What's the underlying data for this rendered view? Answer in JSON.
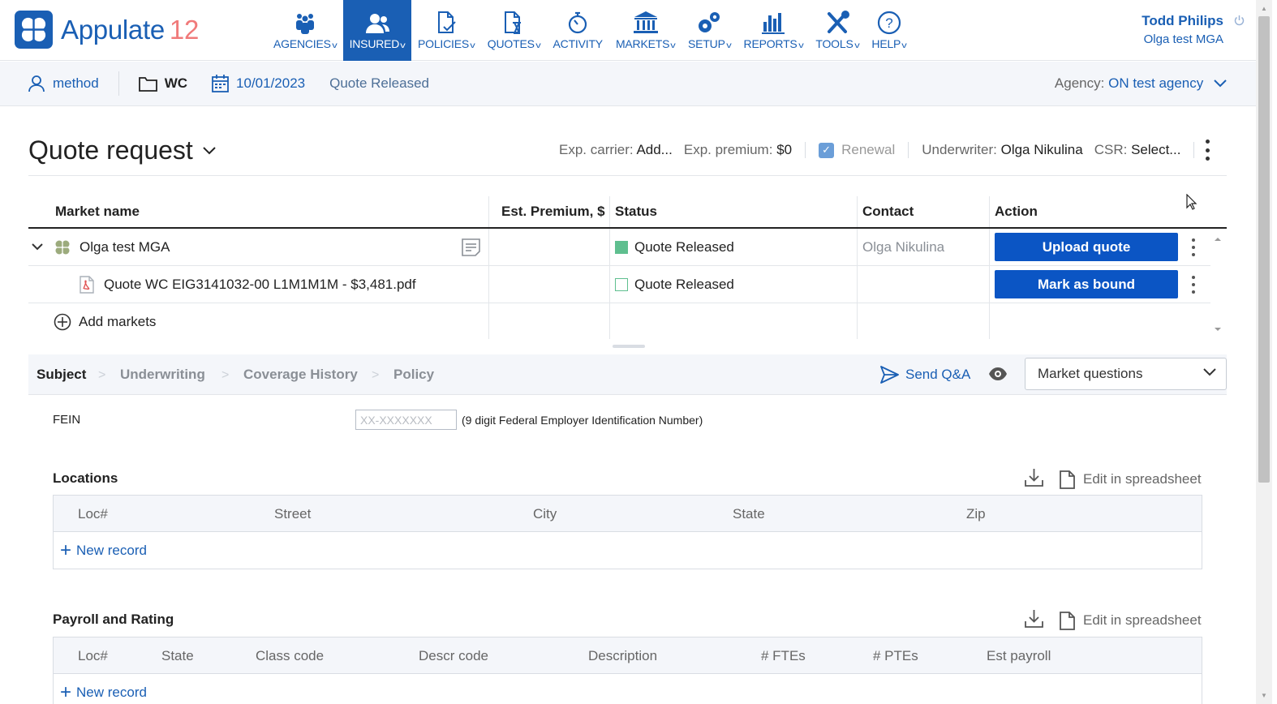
{
  "brand": {
    "name": "Appulate",
    "version": "12"
  },
  "nav": [
    {
      "label": "AGENCIES",
      "icon": "agencies-icon",
      "active": false
    },
    {
      "label": "INSURED",
      "icon": "insured-icon",
      "active": true
    },
    {
      "label": "POLICIES",
      "icon": "policies-icon",
      "active": false
    },
    {
      "label": "QUOTES",
      "icon": "quotes-icon",
      "active": false
    },
    {
      "label": "ACTIVITY",
      "icon": "activity-icon",
      "active": false
    },
    {
      "label": "MARKETS",
      "icon": "markets-icon",
      "active": false
    },
    {
      "label": "SETUP",
      "icon": "setup-icon",
      "active": false
    },
    {
      "label": "REPORTS",
      "icon": "reports-icon",
      "active": false
    },
    {
      "label": "TOOLS",
      "icon": "tools-icon",
      "active": false
    },
    {
      "label": "HELP",
      "icon": "help-icon",
      "active": false
    }
  ],
  "user": {
    "name": "Todd Philips",
    "org": "Olga test MGA"
  },
  "subheader": {
    "insured": "method",
    "lob": "WC",
    "date": "10/01/2023",
    "status": "Quote Released",
    "agency_label": "Agency:",
    "agency_value": "ON test agency"
  },
  "quote": {
    "title": "Quote request",
    "exp_carrier_label": "Exp. carrier:",
    "exp_carrier_value": "Add...",
    "exp_premium_label": "Exp. premium:",
    "exp_premium_value": "$0",
    "renewal_label": "Renewal",
    "underwriter_label": "Underwriter:",
    "underwriter_value": "Olga Nikulina",
    "csr_label": "CSR:",
    "csr_value": "Select..."
  },
  "markets_table": {
    "headers": {
      "market": "Market name",
      "premium": "Est. Premium, $",
      "status": "Status",
      "contact": "Contact",
      "action": "Action"
    },
    "rows": [
      {
        "name": "Olga test MGA",
        "status": "Quote Released",
        "contact": "Olga Nikulina",
        "action": "Upload quote"
      },
      {
        "name": "Quote WC EIG3141032-00 L1M1M1M - $3,481.pdf",
        "status": "Quote Released",
        "contact": "",
        "action": "Mark as bound"
      }
    ],
    "add_markets": "Add markets"
  },
  "tabs": {
    "items": [
      "Subject",
      "Underwriting",
      "Coverage History",
      "Policy"
    ],
    "send_qa": "Send Q&A",
    "select_value": "Market questions"
  },
  "fein": {
    "label": "FEIN",
    "placeholder": "XX-XXXXXXX",
    "hint": "(9 digit Federal Employer Identification Number)"
  },
  "locations": {
    "title": "Locations",
    "edit_label": "Edit in spreadsheet",
    "columns": [
      "Loc#",
      "Street",
      "City",
      "State",
      "Zip"
    ],
    "new_record": "New record"
  },
  "payroll": {
    "title": "Payroll and Rating",
    "edit_label": "Edit in spreadsheet",
    "columns": [
      "Loc#",
      "State",
      "Class code",
      "Descr code",
      "Description",
      "# FTEs",
      "# PTEs",
      "Est payroll"
    ],
    "new_record": "New record"
  },
  "colors": {
    "brand": "#1a5fb4",
    "button": "#0b55c4",
    "status_green": "#5fbf8f",
    "version": "#f07a7a"
  }
}
